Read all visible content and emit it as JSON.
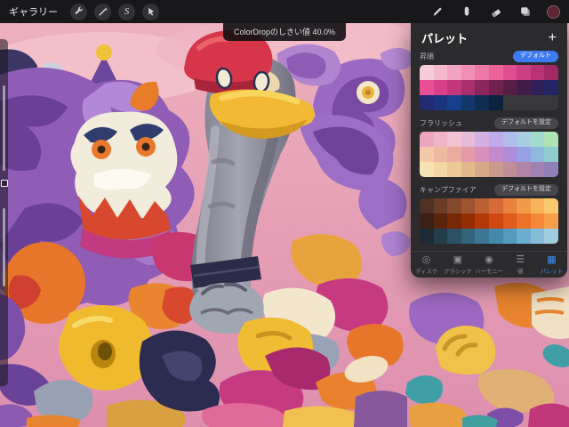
{
  "toolbar": {
    "gallery_label": "ギャラリー",
    "selection_glyph": "S",
    "left_tools": [
      "wrench-icon",
      "magic-wand-icon",
      "selection-icon",
      "transform-arrow-icon"
    ],
    "right_tools": [
      "brush-icon",
      "smudge-icon",
      "eraser-icon",
      "layers-icon",
      "current-color-swatch"
    ],
    "current_color": "#5c2531"
  },
  "notification": {
    "text": "ColorDropのしきい値 40.0%"
  },
  "sidebar": {
    "controls": [
      "brush-size-slider",
      "modify-button",
      "opacity-slider"
    ]
  },
  "palette_panel": {
    "title": "パレット",
    "add_label": "+",
    "palettes": [
      {
        "name": "昇順",
        "badge": "デフォルト",
        "is_default": true,
        "colors": [
          "#f6ccd9",
          "#f4b8cd",
          "#f2a3c1",
          "#f08eb5",
          "#ee79a9",
          "#ec639c",
          "#e04e90",
          "#cc3f82",
          "#b83274",
          "#a22866",
          "#ea4f95",
          "#d84189",
          "#c2377b",
          "#a82e6c",
          "#8c275c",
          "#70214e",
          "#571d44",
          "#421c48",
          "#301e56",
          "#232465",
          "#202b72",
          "#1b347f",
          "#173f8c",
          "#12386b",
          "#0f2d53",
          "#0c2340",
          null,
          null,
          null,
          null
        ]
      },
      {
        "name": "フラリッシュ",
        "badge": "デフォルトを設定",
        "is_default": false,
        "colors": [
          "#eba6bc",
          "#efb4c7",
          "#f3c3d3",
          "#e5bbd9",
          "#d2b0e3",
          "#bfabe9",
          "#b1bdea",
          "#a8cfe1",
          "#a3dbca",
          "#aee3b3",
          "#f4c9a9",
          "#f0b9a1",
          "#ecab9f",
          "#e49aa9",
          "#d98fbb",
          "#c688cc",
          "#ae8cda",
          "#97a0e2",
          "#8fb8dd",
          "#8fcdd1",
          "#f6e3b3",
          "#f2d7a3",
          "#ecc995",
          "#e3b98b",
          "#d8a988",
          "#cc9a8d",
          "#bf8e99",
          "#b085a7",
          "#a181b1",
          "#9181b9"
        ]
      },
      {
        "name": "キャンプファイア",
        "badge": "デフォルトを設定",
        "is_default": false,
        "colors": [
          "#4e3024",
          "#693c28",
          "#84482c",
          "#9f5430",
          "#ba6034",
          "#d56c38",
          "#e8823c",
          "#f29a48",
          "#f8b258",
          "#fac96c",
          "#3a2014",
          "#58240c",
          "#762804",
          "#942c00",
          "#b23808",
          "#d04810",
          "#e05c1c",
          "#ec7228",
          "#f48838",
          "#f89e48",
          "#1c2a34",
          "#243d4c",
          "#2c5064",
          "#34637c",
          "#3c7694",
          "#4489ac",
          "#549ac0",
          "#6cacd0",
          "#84bcd8",
          "#a0ccdf"
        ]
      }
    ],
    "tabs": [
      {
        "label": "ディスク",
        "icon": "disc-icon",
        "glyph": "◎",
        "active": false
      },
      {
        "label": "クラシック",
        "icon": "classic-icon",
        "glyph": "▣",
        "active": false
      },
      {
        "label": "ハーモニー",
        "icon": "harmony-icon",
        "glyph": "◉",
        "active": false
      },
      {
        "label": "値",
        "icon": "value-icon",
        "glyph": "☰",
        "active": false
      },
      {
        "label": "パレット",
        "icon": "palettes-icon",
        "glyph": "▦",
        "active": true
      }
    ],
    "accent_color": "#3d8df5"
  }
}
